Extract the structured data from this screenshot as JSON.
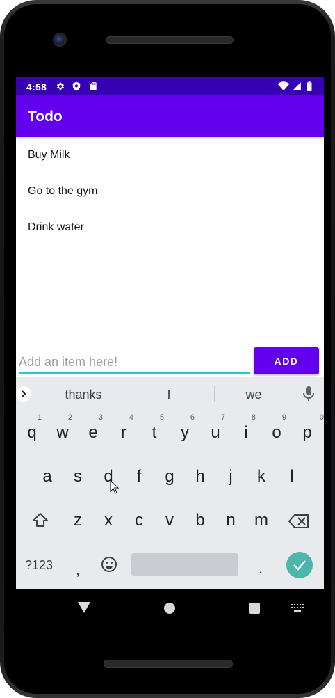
{
  "status_bar": {
    "time": "4:58"
  },
  "app_bar": {
    "title": "Todo"
  },
  "todo_items": [
    {
      "text": "Buy Milk"
    },
    {
      "text": "Go to the gym"
    },
    {
      "text": "Drink water"
    }
  ],
  "input": {
    "placeholder": "Add an item here!",
    "value": ""
  },
  "add_button": {
    "label": "ADD"
  },
  "keyboard": {
    "suggestions": [
      "thanks",
      "I",
      "we"
    ],
    "row1": [
      {
        "key": "q",
        "hint": "1"
      },
      {
        "key": "w",
        "hint": "2"
      },
      {
        "key": "e",
        "hint": "3"
      },
      {
        "key": "r",
        "hint": "4"
      },
      {
        "key": "t",
        "hint": "5"
      },
      {
        "key": "y",
        "hint": "6"
      },
      {
        "key": "u",
        "hint": "7"
      },
      {
        "key": "i",
        "hint": "8"
      },
      {
        "key": "o",
        "hint": "9"
      },
      {
        "key": "p",
        "hint": "0"
      }
    ],
    "row2": [
      "a",
      "s",
      "d",
      "f",
      "g",
      "h",
      "j",
      "k",
      "l"
    ],
    "row3": [
      "z",
      "x",
      "c",
      "v",
      "b",
      "n",
      "m"
    ],
    "symbols_label": "?123",
    "comma_label": ",",
    "period_label": "."
  },
  "colors": {
    "status_bar": "#3700b3",
    "primary": "#6200ee",
    "input_underline": "#26c6da",
    "enter_key": "#4db6ac",
    "keyboard_bg": "#e8eaed"
  },
  "icons": [
    "gear-icon",
    "shield-icon",
    "sd-card-icon",
    "wifi-icon",
    "signal-icon",
    "battery-icon",
    "chevron-right-icon",
    "mic-icon",
    "shift-icon",
    "backspace-icon",
    "emoji-icon",
    "check-icon",
    "nav-back-icon",
    "nav-home-icon",
    "nav-recents-icon",
    "keyboard-switch-icon",
    "mouse-cursor-icon"
  ]
}
